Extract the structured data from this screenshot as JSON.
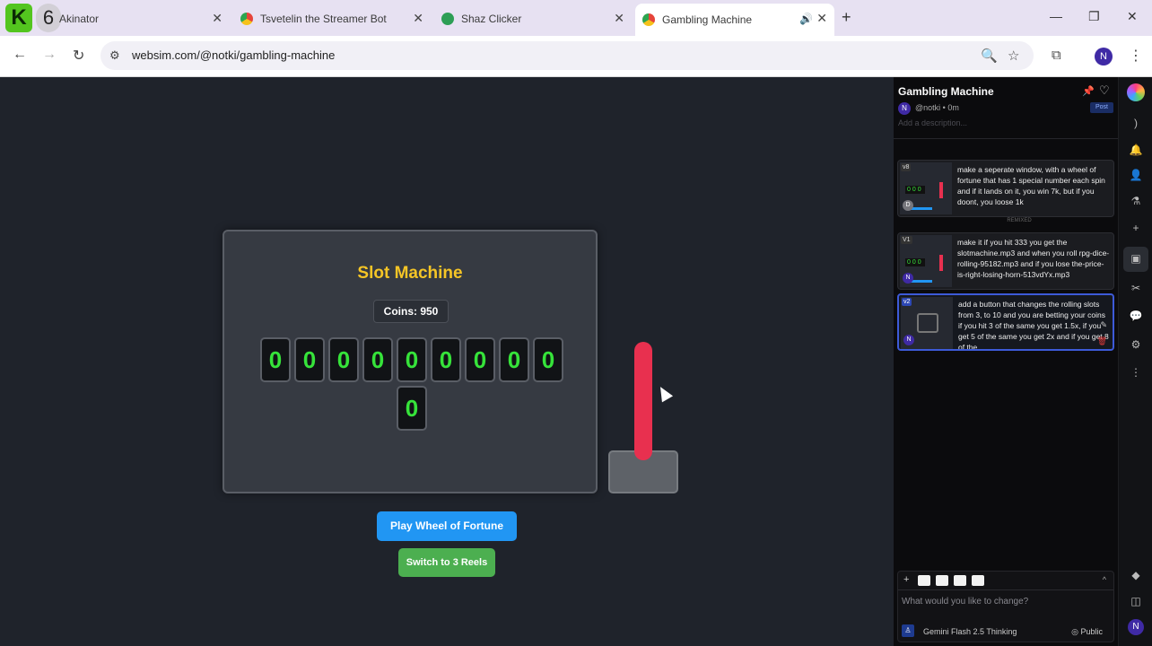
{
  "browser": {
    "tabs": [
      {
        "title": "Akinator",
        "favicon": "akinator-icon"
      },
      {
        "title": "Tsvetelin the Streamer Bot",
        "favicon": "chrome-icon"
      },
      {
        "title": "Shaz Clicker",
        "favicon": "check-icon"
      },
      {
        "title": "Gambling Machine",
        "favicon": "chrome-icon",
        "active": true
      }
    ],
    "k_logo": "K",
    "tab_count_badge": "6",
    "url": "websim.com/@notki/gambling-machine",
    "profile_initial": "N"
  },
  "slot": {
    "title": "Slot Machine",
    "coins_label": "Coins: 950",
    "reels": [
      "0",
      "0",
      "0",
      "0",
      "0",
      "0",
      "0",
      "0",
      "0",
      "0"
    ]
  },
  "buttons": {
    "wheel": "Play Wheel of Fortune",
    "switch": "Switch to 3 Reels"
  },
  "sidebar": {
    "title": "Gambling Machine",
    "author_initial": "N",
    "author": "@notki",
    "time": "0m",
    "post": "Post",
    "description_placeholder": "Add a description...",
    "versions": [
      {
        "label": "v8",
        "avatar": "D",
        "text": "make a seperate window, with a wheel of fortune that has 1 special number each spin and if it lands on it, you win 7k, but if you doont, you loose 1k"
      },
      {
        "label": "V1",
        "avatar": "N",
        "text": "make it if you hit 333 you get the slotmachine.mp3 and when you roll rpg-dice-rolling-95182.mp3 and if you lose the-price-is-right-losing-horn-513vdYx.mp3"
      },
      {
        "label": "v2",
        "avatar": "N",
        "text": "add a button that changes the rolling slots from 3, to 10 and you are betting your coins if you hit 3 of the same you get 1.5x, if you get 5 of the same you get 2x and if you get 8 of the"
      }
    ],
    "remixed_label": "REMIXED",
    "mini_reels": "000",
    "composer_placeholder": "What would you like to change?",
    "model_name": "Gemini Flash 2.5 Thinking",
    "visibility": "Public"
  },
  "colors": {
    "accent_blue": "#2196f3",
    "accent_green": "#4caf50",
    "title_yellow": "#f5c526",
    "reel_digit": "#36e33a",
    "lever": "#e8304f"
  }
}
